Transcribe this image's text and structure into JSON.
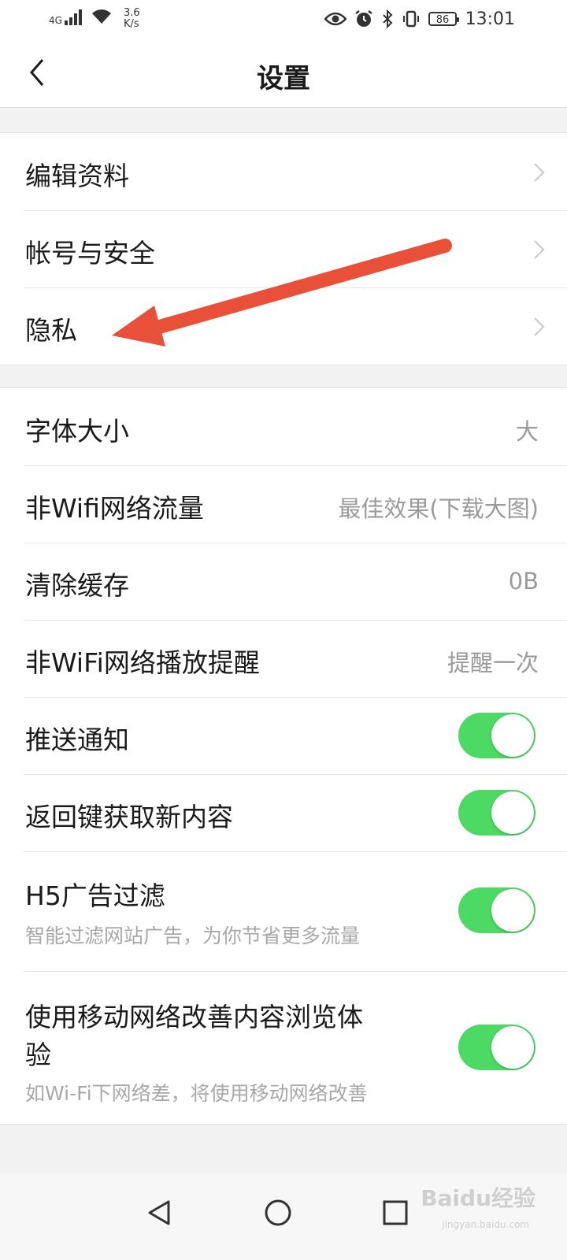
{
  "status_bar": {
    "network": "4G",
    "speed_value": "3.6",
    "speed_unit": "K/s",
    "battery": "86",
    "time": "13:01"
  },
  "header": {
    "title": "设置",
    "back_icon": "chevron-left-icon"
  },
  "group1": {
    "items": [
      {
        "label": "编辑资料"
      },
      {
        "label": "帐号与安全"
      },
      {
        "label": "隐私"
      }
    ]
  },
  "group2": {
    "items": [
      {
        "label": "字体大小",
        "value": "大"
      },
      {
        "label": "非Wifi网络流量",
        "value": "最佳效果(下载大图)"
      },
      {
        "label": "清除缓存",
        "value": "0B"
      },
      {
        "label": "非WiFi网络播放提醒",
        "value": "提醒一次"
      },
      {
        "label": "推送通知",
        "toggle": true
      },
      {
        "label": "返回键获取新内容",
        "toggle": true
      },
      {
        "label": "H5广告过滤",
        "sub": "智能过滤网站广告，为你节省更多流量",
        "toggle": true
      },
      {
        "label": "使用移动网络改善内容浏览体",
        "label_line2": "验",
        "sub": "如Wi-Fi下网络差，将使用移动网络改善",
        "toggle": true
      }
    ]
  },
  "colors": {
    "toggle_on": "#4cd964",
    "annotation_arrow": "#e8503a"
  },
  "nav_bar": {
    "back": "triangle-back-icon",
    "home": "circle-home-icon",
    "recent": "square-recent-icon"
  },
  "watermark": {
    "text": "Baidu经验",
    "sub": "jingyan.baidu.com"
  }
}
